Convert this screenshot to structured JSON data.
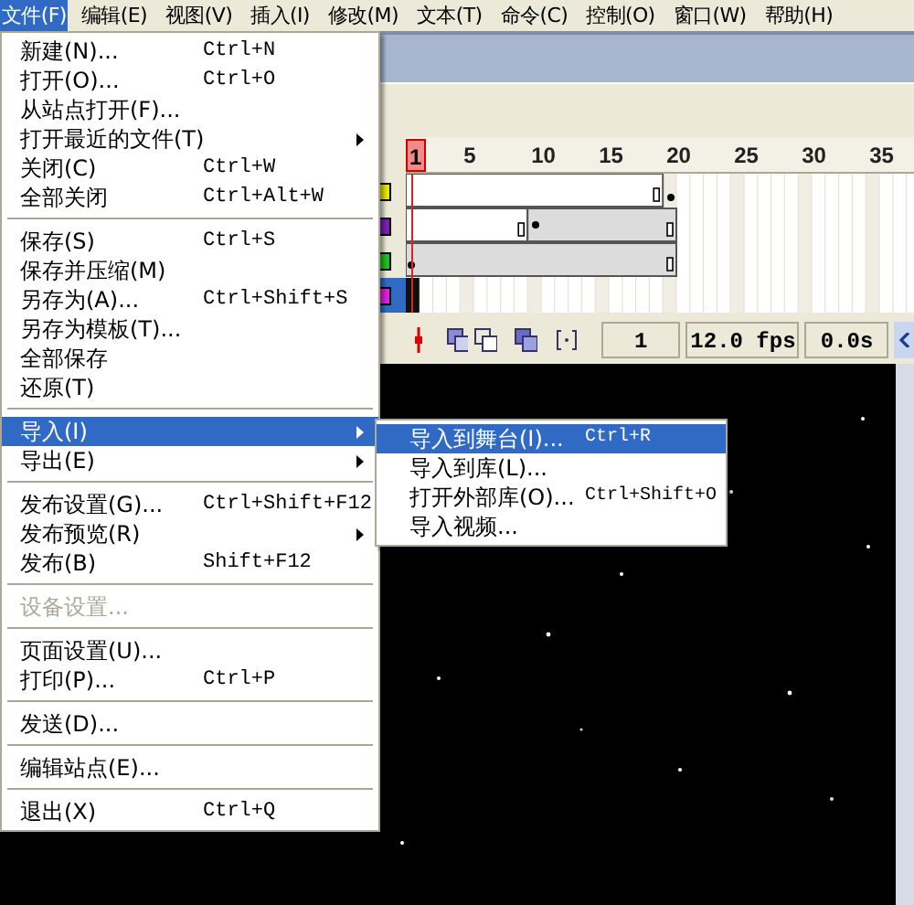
{
  "menu_bar": [
    {
      "label": "文件(F)",
      "selected": true
    },
    {
      "label": "编辑(E)",
      "selected": false
    },
    {
      "label": "视图(V)",
      "selected": false
    },
    {
      "label": "插入(I)",
      "selected": false
    },
    {
      "label": "修改(M)",
      "selected": false
    },
    {
      "label": "文本(T)",
      "selected": false
    },
    {
      "label": "命令(C)",
      "selected": false
    },
    {
      "label": "控制(O)",
      "selected": false
    },
    {
      "label": "窗口(W)",
      "selected": false
    },
    {
      "label": "帮助(H)",
      "selected": false
    }
  ],
  "file_menu": [
    {
      "kind": "item",
      "label": "新建(N)...",
      "shortcut": "Ctrl+N",
      "selected": false,
      "disabled": false,
      "submenu": false
    },
    {
      "kind": "item",
      "label": "打开(O)...",
      "shortcut": "Ctrl+O",
      "selected": false,
      "disabled": false,
      "submenu": false
    },
    {
      "kind": "item",
      "label": "从站点打开(F)...",
      "selected": false,
      "disabled": false,
      "submenu": false
    },
    {
      "kind": "item",
      "label": "打开最近的文件(T)",
      "selected": false,
      "disabled": false,
      "submenu": true
    },
    {
      "kind": "item",
      "label": "关闭(C)",
      "shortcut": "Ctrl+W",
      "selected": false,
      "disabled": false,
      "submenu": false
    },
    {
      "kind": "item",
      "label": "全部关闭",
      "shortcut": "Ctrl+Alt+W",
      "selected": false,
      "disabled": false,
      "submenu": false
    },
    {
      "kind": "separator"
    },
    {
      "kind": "item",
      "label": "保存(S)",
      "shortcut": "Ctrl+S",
      "selected": false,
      "disabled": false,
      "submenu": false
    },
    {
      "kind": "item",
      "label": "保存并压缩(M)",
      "selected": false,
      "disabled": false,
      "submenu": false
    },
    {
      "kind": "item",
      "label": "另存为(A)...",
      "shortcut": "Ctrl+Shift+S",
      "selected": false,
      "disabled": false,
      "submenu": false
    },
    {
      "kind": "item",
      "label": "另存为模板(T)...",
      "selected": false,
      "disabled": false,
      "submenu": false
    },
    {
      "kind": "item",
      "label": "全部保存",
      "selected": false,
      "disabled": false,
      "submenu": false
    },
    {
      "kind": "item",
      "label": "还原(T)",
      "selected": false,
      "disabled": false,
      "submenu": false
    },
    {
      "kind": "separator"
    },
    {
      "kind": "item",
      "label": "导入(I)",
      "selected": true,
      "disabled": false,
      "submenu": true
    },
    {
      "kind": "item",
      "label": "导出(E)",
      "selected": false,
      "disabled": false,
      "submenu": true
    },
    {
      "kind": "separator"
    },
    {
      "kind": "item",
      "label": "发布设置(G)...",
      "shortcut": "Ctrl+Shift+F12",
      "selected": false,
      "disabled": false,
      "submenu": false
    },
    {
      "kind": "item",
      "label": "发布预览(R)",
      "selected": false,
      "disabled": false,
      "submenu": true
    },
    {
      "kind": "item",
      "label": "发布(B)",
      "shortcut": "Shift+F12",
      "selected": false,
      "disabled": false,
      "submenu": false
    },
    {
      "kind": "separator"
    },
    {
      "kind": "item",
      "label": "设备设置...",
      "selected": false,
      "disabled": true,
      "submenu": false
    },
    {
      "kind": "separator"
    },
    {
      "kind": "item",
      "label": "页面设置(U)...",
      "selected": false,
      "disabled": false,
      "submenu": false
    },
    {
      "kind": "item",
      "label": "打印(P)...",
      "shortcut": "Ctrl+P",
      "selected": false,
      "disabled": false,
      "submenu": false
    },
    {
      "kind": "separator"
    },
    {
      "kind": "item",
      "label": "发送(D)...",
      "selected": false,
      "disabled": false,
      "submenu": false
    },
    {
      "kind": "separator"
    },
    {
      "kind": "item",
      "label": "编辑站点(E)...",
      "selected": false,
      "disabled": false,
      "submenu": false
    },
    {
      "kind": "separator"
    },
    {
      "kind": "item",
      "label": "退出(X)",
      "shortcut": "Ctrl+Q",
      "selected": false,
      "disabled": false,
      "submenu": false
    }
  ],
  "import_submenu": [
    {
      "label": "导入到舞台(I)...",
      "shortcut": "Ctrl+R",
      "selected": true
    },
    {
      "label": "导入到库(L)...",
      "selected": false
    },
    {
      "label": "打开外部库(O)...",
      "shortcut": "Ctrl+Shift+O",
      "selected": false
    },
    {
      "label": "导入视频...",
      "selected": false
    }
  ],
  "timeline": {
    "ruler": [
      {
        "label": "1",
        "current": true
      },
      {
        "label": "5",
        "current": false
      },
      {
        "label": "10",
        "current": false
      },
      {
        "label": "15",
        "current": false
      },
      {
        "label": "20",
        "current": false
      },
      {
        "label": "25",
        "current": false
      },
      {
        "label": "30",
        "current": false
      },
      {
        "label": "35",
        "current": false
      }
    ],
    "layers": [
      {
        "color": "#e8e800",
        "selected": false
      },
      {
        "color": "#7a1fb8",
        "selected": false
      },
      {
        "color": "#22c022",
        "selected": false
      },
      {
        "color": "#e020e0",
        "selected": true
      }
    ],
    "current_frame": "1",
    "frame_rate": "12.0 fps",
    "elapsed_time": "0.0s"
  }
}
